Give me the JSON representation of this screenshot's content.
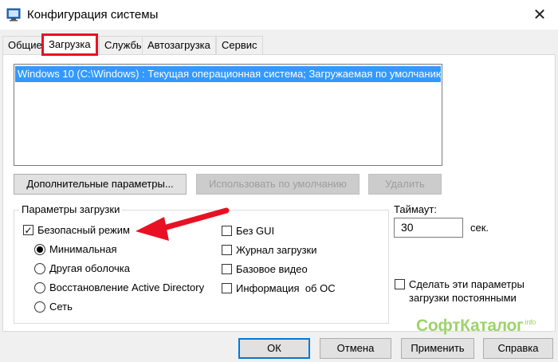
{
  "window": {
    "title": "Конфигурация системы",
    "close_glyph": "✕"
  },
  "tabs": [
    "Общие",
    "Загрузка",
    "Службы",
    "Автозагрузка",
    "Сервис"
  ],
  "os_list": {
    "selected": "Windows 10 (C:\\Windows) : Текущая операционная система; Загружаемая по умолчанию ОС"
  },
  "buttons": {
    "advanced": "Дополнительные параметры...",
    "default": "Использовать по умолчанию",
    "delete": "Удалить"
  },
  "boot_options": {
    "title": "Параметры загрузки",
    "safe_mode": {
      "label": "Безопасный режим",
      "checked": true
    },
    "radios": [
      {
        "label": "Минимальная",
        "selected": true
      },
      {
        "label": "Другая оболочка",
        "selected": false
      },
      {
        "label": "Восстановление Active Directory",
        "selected": false
      },
      {
        "label": "Сеть",
        "selected": false
      }
    ],
    "right": [
      {
        "label": "Без GUI",
        "checked": false
      },
      {
        "label": "Журнал загрузки",
        "checked": false
      },
      {
        "label": "Базовое видео",
        "checked": false
      },
      {
        "label": "Информация  об ОС",
        "checked": false
      }
    ]
  },
  "timeout": {
    "label": "Таймаут:",
    "value": "30",
    "unit": "сек."
  },
  "persistent": {
    "line1": "Сделать эти параметры",
    "line2": "загрузки постоянными",
    "checked": false
  },
  "footer": {
    "ok": "ОК",
    "cancel": "Отмена",
    "apply": "Применить",
    "help": "Справка"
  },
  "watermark": {
    "text": "СофтКаталог",
    "suffix": ".info"
  },
  "colors": {
    "highlight_border": "#e81123",
    "selection": "#3399ff",
    "arrow": "#e81123",
    "watermark": "#9dd36a"
  }
}
